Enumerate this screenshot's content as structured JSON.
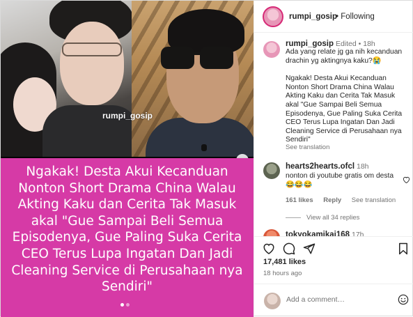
{
  "colors": {
    "headline_bg": "#d63aa6",
    "follow_text": "#262626",
    "muted": "#737373"
  },
  "media": {
    "watermark": "rumpi_gosip",
    "next_icon": "chevron-right-icon",
    "headline": "Ngakak! Desta Akui Kecanduan Nonton Short Drama China Walau Akting Kaku dan Cerita Tak Masuk akal \"Gue Sampai Beli Semua Episodenya, Gue Paling Suka Cerita CEO Terus Lupa Ingatan Dan Jadi Cleaning Service di Perusahaan nya Sendiri\""
  },
  "header": {
    "username": "rumpi_gosip",
    "separator": "•",
    "follow_label": "Following"
  },
  "caption": {
    "username": "rumpi_gosip",
    "edited": "Edited",
    "dot": "•",
    "time": "18h",
    "line1": "Ada yang relate jg ga nih kecanduan drachin yg aktingnya kaku?😭",
    "line2": "Ngakak! Desta Akui Kecanduan Nonton Short Drama China Walau Akting Kaku dan Cerita Tak Masuk akal \"Gue Sampai Beli Semua Episodenya, Gue Paling Suka Cerita CEO Terus Lupa Ingatan Dan Jadi Cleaning Service di Perusahaan nya Sendiri\"",
    "see_translation": "See translation"
  },
  "comment1": {
    "username": "hearts2hearts.ofcl",
    "time": "18h",
    "text": "nonton di youtube gratis om desta 😂😂😂",
    "likes": "161 likes",
    "reply": "Reply",
    "see_translation": "See translation",
    "view_replies": "View all 34 replies"
  },
  "comment2": {
    "username": "tokyokamikai168",
    "time": "17h"
  },
  "actions": {
    "likes_count": "17,481 likes",
    "time_ago": "18 hours ago"
  },
  "add_comment": {
    "placeholder": "Add a comment…"
  }
}
